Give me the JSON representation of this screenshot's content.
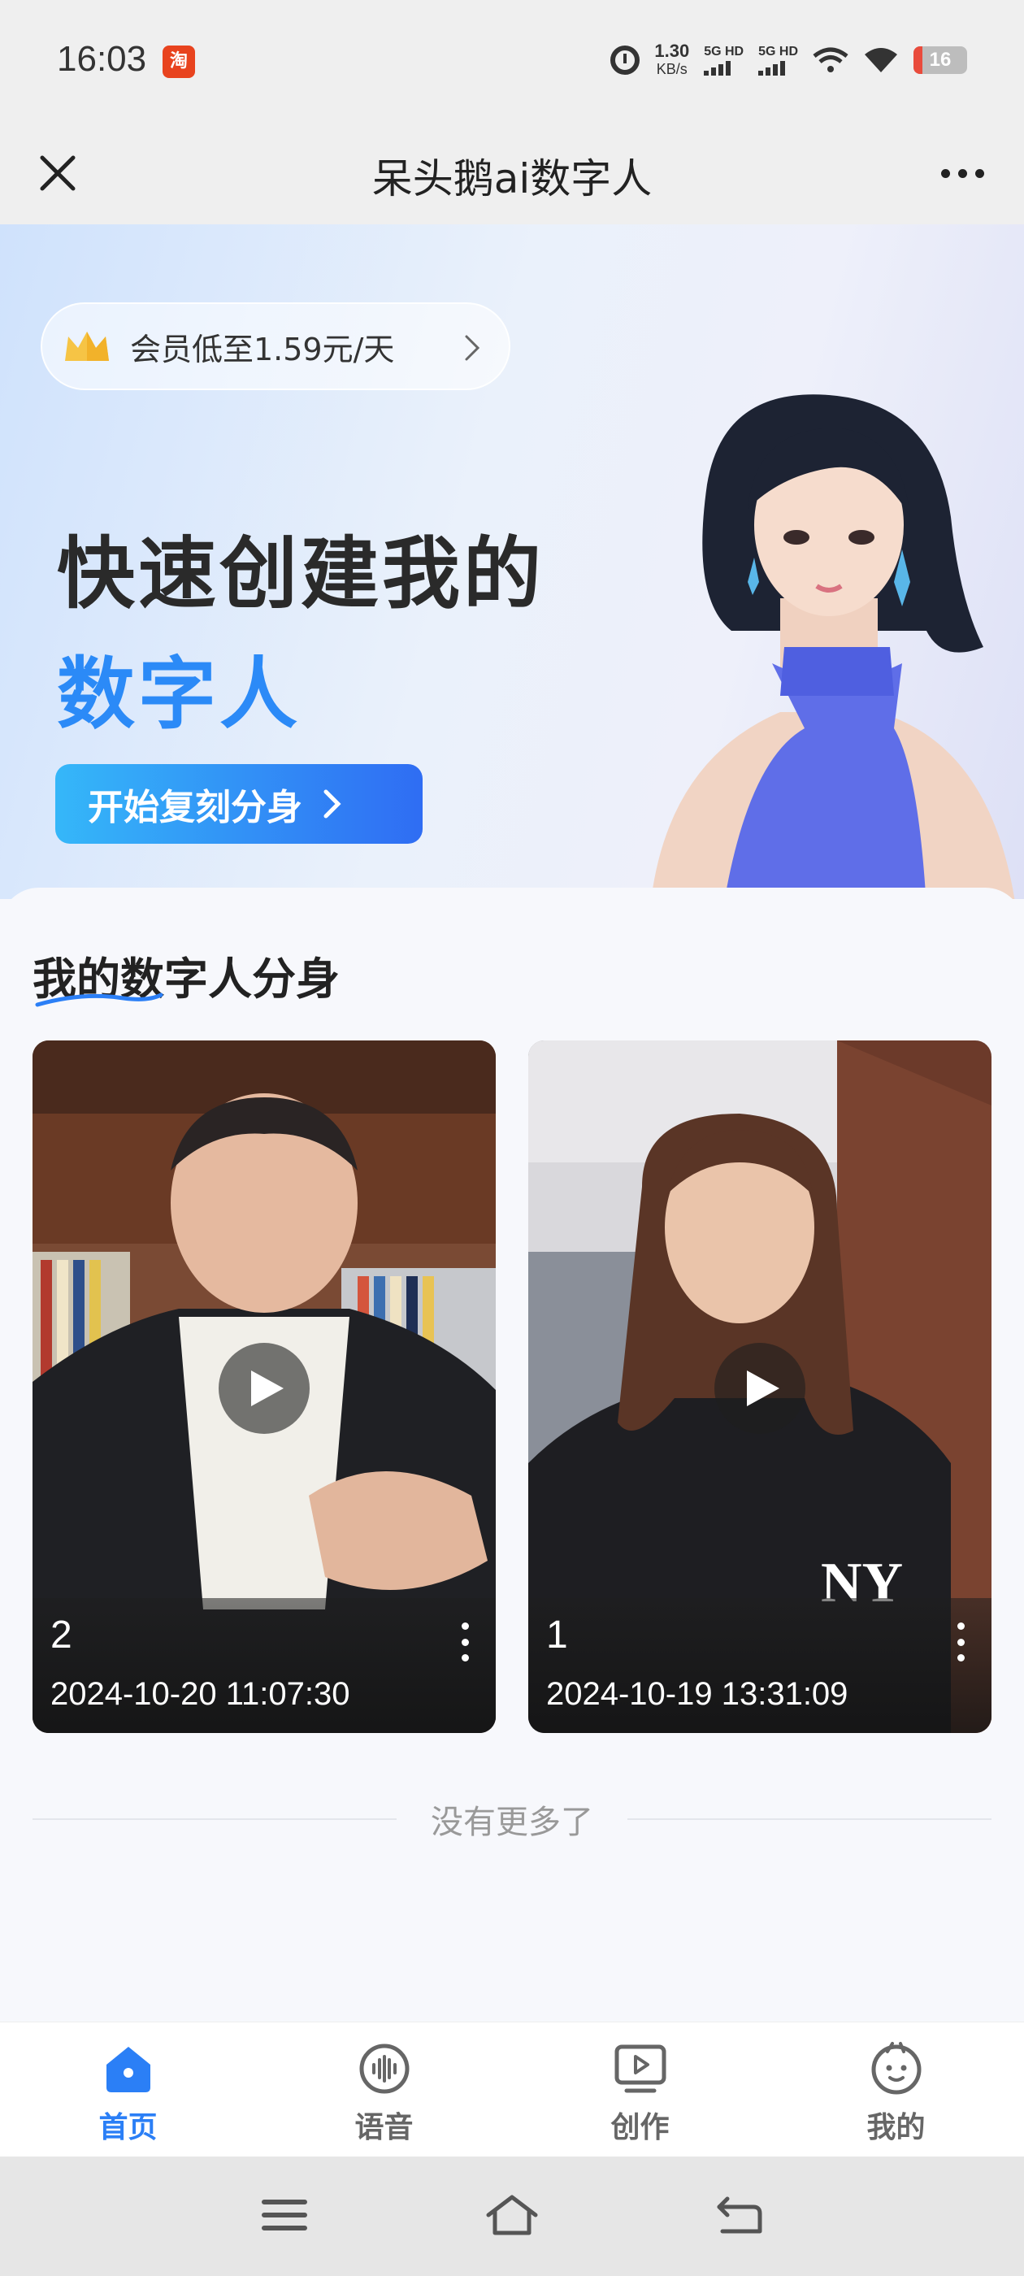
{
  "status_bar": {
    "time": "16:03",
    "app_icon_text": "淘",
    "net_speed_value": "1.30",
    "net_speed_unit": "KB/s",
    "sim1_label": "5G HD",
    "sim2_label": "5G HD",
    "battery": "16"
  },
  "title_bar": {
    "title": "呆头鹅ai数字人"
  },
  "hero": {
    "vip_text": "会员低至1.59元/天",
    "headline_line1": "快速创建我的",
    "headline_line2": "数字人",
    "cta_label": "开始复刻分身"
  },
  "section": {
    "title": "我的数字人分身"
  },
  "clones": [
    {
      "name": "2",
      "date": "2024-10-20 11:07:30"
    },
    {
      "name": "1",
      "date": "2024-10-19 13:31:09"
    }
  ],
  "list_end_text": "没有更多了",
  "bottom_nav": {
    "items": [
      {
        "label": "首页",
        "icon": "home-icon",
        "active": true
      },
      {
        "label": "语音",
        "icon": "voice-icon",
        "active": false
      },
      {
        "label": "创作",
        "icon": "create-icon",
        "active": false
      },
      {
        "label": "我的",
        "icon": "profile-icon",
        "active": false
      }
    ]
  },
  "colors": {
    "accent": "#2b7ff6",
    "cta_start": "#35b7f9",
    "cta_end": "#2f6df3",
    "battery_low": "#e94b3c"
  }
}
